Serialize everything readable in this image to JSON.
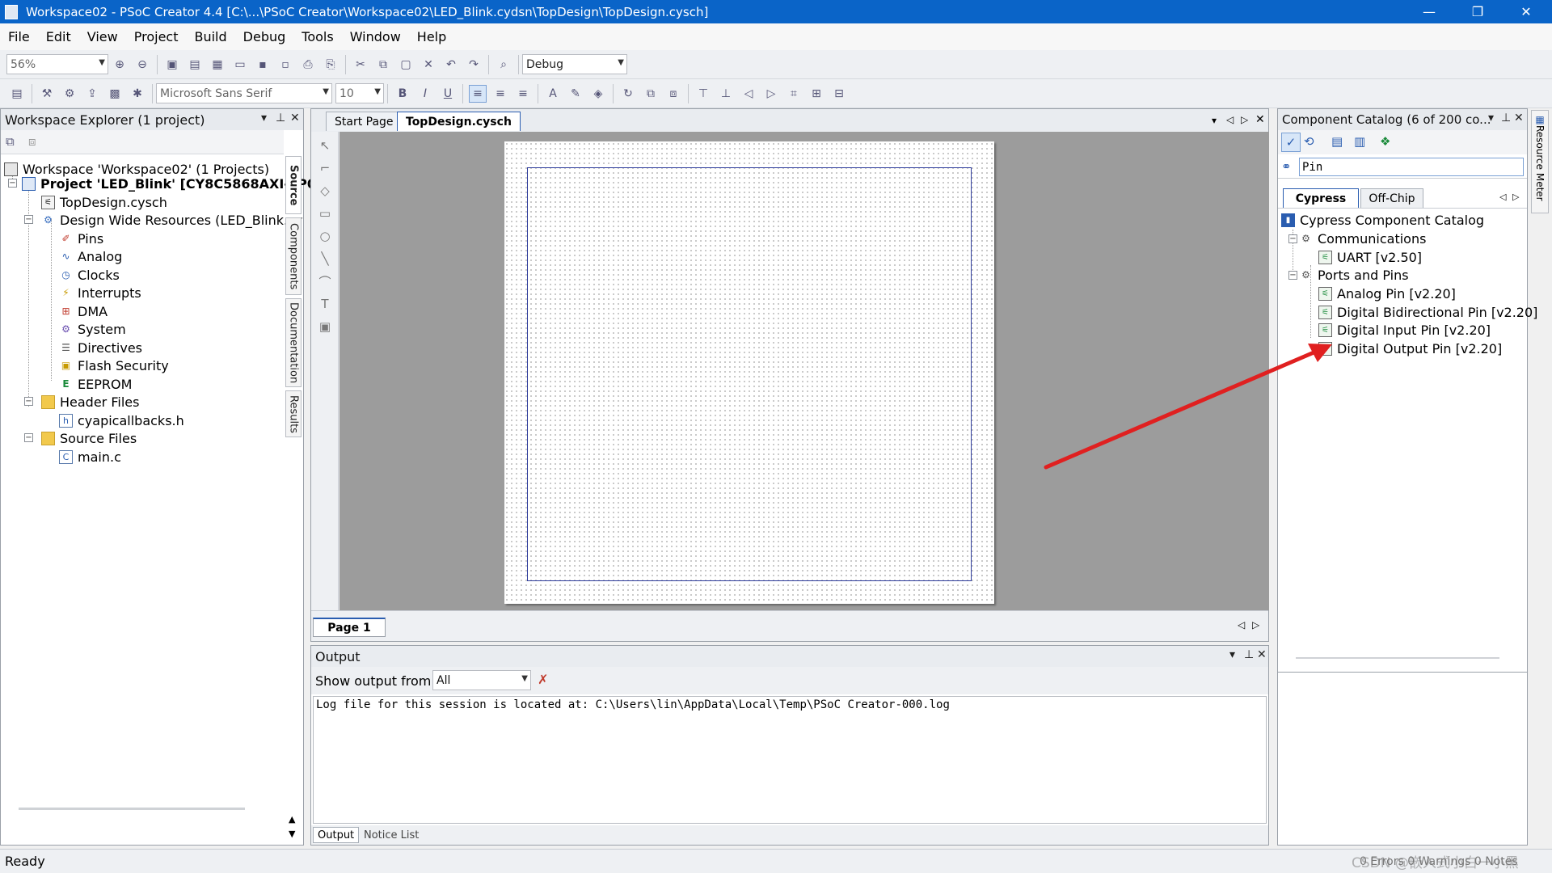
{
  "window": {
    "title": "Workspace02 - PSoC Creator 4.4  [C:\\...\\PSoC Creator\\Workspace02\\LED_Blink.cydsn\\TopDesign\\TopDesign.cysch]",
    "minimize": "—",
    "restore": "❐",
    "close": "✕"
  },
  "menu": [
    "File",
    "Edit",
    "View",
    "Project",
    "Build",
    "Debug",
    "Tools",
    "Window",
    "Help"
  ],
  "toolbar": {
    "zoom": "56%",
    "config": "Debug",
    "font": "Microsoft Sans Serif",
    "font_size": "10"
  },
  "workspace_explorer": {
    "title": "Workspace Explorer (1 project)",
    "tree": {
      "workspace": "Workspace 'Workspace02' (1 Projects)",
      "project": "Project  'LED_Blink'  [CY8C5868AXI-LP0",
      "topdesign": "TopDesign.cysch",
      "dwr": "Design Wide Resources (LED_Blink.cy",
      "dwr_items": [
        "Pins",
        "Analog",
        "Clocks",
        "Interrupts",
        "DMA",
        "System",
        "Directives",
        "Flash Security",
        "EEPROM"
      ],
      "header_files": "Header Files",
      "header_items": [
        "cyapicallbacks.h"
      ],
      "source_files": "Source Files",
      "source_items": [
        "main.c"
      ]
    },
    "side_tabs": [
      "Source",
      "Components",
      "Documentation",
      "Results"
    ]
  },
  "editor": {
    "tabs": [
      "Start Page",
      "TopDesign.cysch"
    ],
    "active_tab": "TopDesign.cysch",
    "page_tab": "Page 1"
  },
  "output": {
    "title": "Output",
    "show_from_label": "Show output from:",
    "show_from_value": "All",
    "log": "Log file for this session is located at: C:\\Users\\lin\\AppData\\Local\\Temp\\PSoC Creator-000.log",
    "tabs": [
      "Output",
      "Notice List"
    ]
  },
  "catalog": {
    "title": "Component Catalog (6 of 200 co...",
    "search": "Pin",
    "tabs": [
      "Cypress",
      "Off-Chip"
    ],
    "root": "Cypress Component Catalog",
    "groups": [
      {
        "name": "Communications",
        "items": [
          "UART [v2.50]"
        ]
      },
      {
        "name": "Ports and Pins",
        "items": [
          "Analog Pin [v2.20]",
          "Digital Bidirectional Pin [v2.20]",
          "Digital Input Pin [v2.20]",
          "Digital Output Pin [v2.20]"
        ]
      }
    ]
  },
  "resource_meter": "Resource Meter",
  "status": {
    "left": "Ready",
    "right": "0 Errors  0 Warnings  0 Notes",
    "watermark": "CSDN @嵌入式小白一小黑"
  },
  "colors": {
    "titlebar": "#0a64c8",
    "accent": "#2a5db0",
    "arrow": "#e02020"
  }
}
